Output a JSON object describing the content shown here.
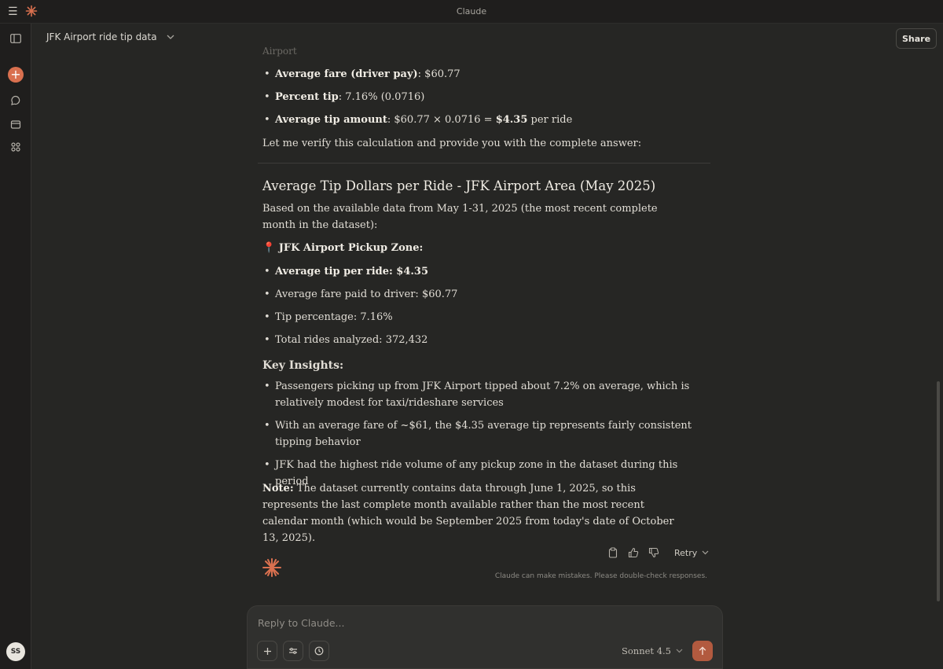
{
  "window": {
    "title": "Claude"
  },
  "header": {
    "chat_title": "JFK Airport ride tip data",
    "share_label": "Share"
  },
  "sidebar": {
    "avatar_initials": "SS"
  },
  "message": {
    "faded_top": "Airport",
    "calc_bullets": [
      {
        "bold": "Average fare (driver pay)",
        "rest": ": $60.77"
      },
      {
        "bold": "Percent tip",
        "rest": ": 7.16% (0.0716)"
      },
      {
        "bold": "Average tip amount",
        "rest": ": $60.77 × 0.0716 = ",
        "bold2": "$4.35",
        "rest2": " per ride"
      }
    ],
    "verify_text": "Let me verify this calculation and provide you with the complete answer:",
    "heading": "Average Tip Dollars per Ride - JFK Airport Area (May 2025)",
    "intro": "Based on the available data from May 1-31, 2025 (the most recent complete month in the dataset):",
    "zone_label": "📍 JFK Airport Pickup Zone:",
    "stats": [
      {
        "bold": "Average tip per ride: $4.35",
        "rest": ""
      },
      {
        "bold": "",
        "rest": "Average fare paid to driver: $60.77"
      },
      {
        "bold": "",
        "rest": "Tip percentage: 7.16%"
      },
      {
        "bold": "",
        "rest": "Total rides analyzed: 372,432"
      }
    ],
    "insights_heading": "Key Insights:",
    "insights": [
      "Passengers picking up from JFK Airport tipped about 7.2% on average, which is relatively modest for taxi/rideshare services",
      "With an average fare of ~$61, the $4.35 average tip represents fairly consistent tipping behavior",
      "JFK had the highest ride volume of any pickup zone in the dataset during this period"
    ],
    "note_label": "Note:",
    "note_text": " The dataset currently contains data through June 1, 2025, so this represents the last complete month available rather than the most recent calendar month (which would be September 2025 from today's date of October 13, 2025)."
  },
  "actions": {
    "retry_label": "Retry",
    "disclaimer": "Claude can make mistakes. Please double-check responses."
  },
  "composer": {
    "placeholder": "Reply to Claude...",
    "model_label": "Sonnet 4.5"
  },
  "colors": {
    "accent": "#d9704f",
    "send": "#b25a3f",
    "background": "#262624"
  }
}
